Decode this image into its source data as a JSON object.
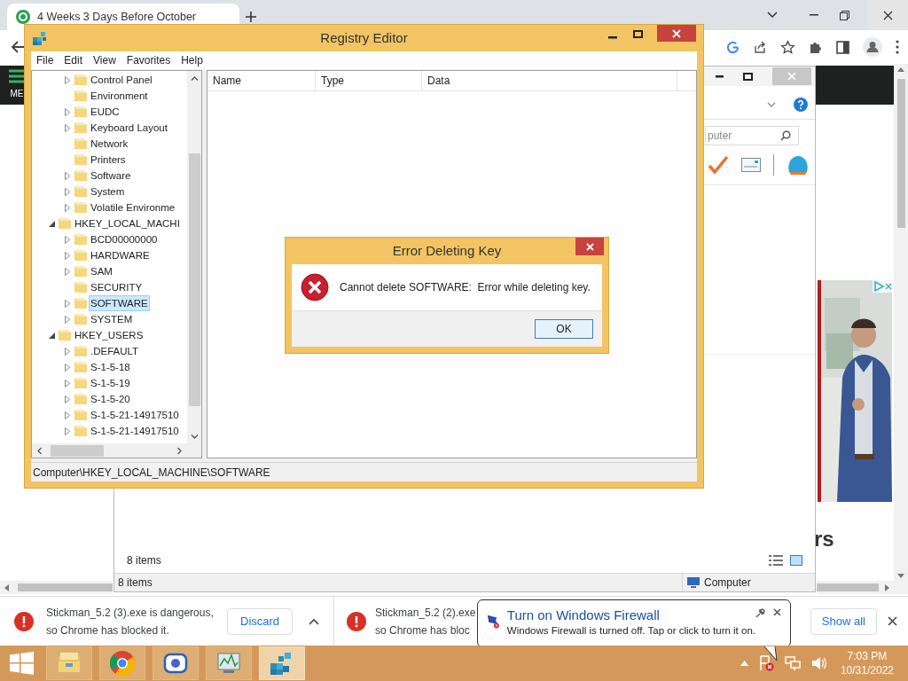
{
  "browser": {
    "tab": {
      "title": "4 Weeks 3 Days Before October"
    }
  },
  "page": {
    "menu_label": "ME",
    "heading_fragment": "rs"
  },
  "explorer": {
    "search": {
      "placeholder": "puter"
    },
    "item_count": "8 items",
    "status_bar": {
      "items": "8 items",
      "location": "Computer"
    }
  },
  "registry_editor": {
    "title": "Registry Editor",
    "menu": [
      "File",
      "Edit",
      "View",
      "Favorites",
      "Help"
    ],
    "tree": [
      {
        "children": [
          {
            "label": "Control Panel",
            "kind": "collapsed",
            "selected": false
          },
          {
            "label": "Environment",
            "kind": "leaf",
            "selected": false
          },
          {
            "label": "EUDC",
            "kind": "collapsed",
            "selected": false
          },
          {
            "label": "Keyboard Layout",
            "kind": "collapsed",
            "selected": false
          },
          {
            "label": "Network",
            "kind": "leaf",
            "selected": false
          },
          {
            "label": "Printers",
            "kind": "leaf",
            "selected": false
          },
          {
            "label": "Software",
            "kind": "collapsed",
            "selected": false
          },
          {
            "label": "System",
            "kind": "collapsed",
            "selected": false
          },
          {
            "label": "Volatile Environme",
            "kind": "collapsed",
            "selected": false
          }
        ]
      },
      {
        "label": "HKEY_LOCAL_MACHI",
        "kind": "expanded",
        "selected": false,
        "children": [
          {
            "label": "BCD00000000",
            "kind": "collapsed",
            "selected": false
          },
          {
            "label": "HARDWARE",
            "kind": "collapsed",
            "selected": false
          },
          {
            "label": "SAM",
            "kind": "collapsed",
            "selected": false
          },
          {
            "label": "SECURITY",
            "kind": "leaf",
            "selected": false
          },
          {
            "label": "SOFTWARE",
            "kind": "collapsed",
            "selected": true
          },
          {
            "label": "SYSTEM",
            "kind": "collapsed",
            "selected": false
          }
        ]
      },
      {
        "label": "HKEY_USERS",
        "kind": "expanded",
        "selected": false,
        "children": [
          {
            "label": ".DEFAULT",
            "kind": "collapsed",
            "selected": false
          },
          {
            "label": "S-1-5-18",
            "kind": "collapsed",
            "selected": false
          },
          {
            "label": "S-1-5-19",
            "kind": "collapsed",
            "selected": false
          },
          {
            "label": "S-1-5-20",
            "kind": "collapsed",
            "selected": false
          },
          {
            "label": "S-1-5-21-14917510",
            "kind": "collapsed",
            "selected": false
          },
          {
            "label": "S-1-5-21-14917510",
            "kind": "collapsed",
            "selected": false
          }
        ]
      }
    ],
    "columns": [
      "Name",
      "Type",
      "Data"
    ],
    "status_bar": "Computer\\HKEY_LOCAL_MACHINE\\SOFTWARE"
  },
  "dialog": {
    "title": "Error Deleting Key",
    "message": "Cannot delete SOFTWARE:  Error while deleting key.",
    "buttons": [
      "OK"
    ]
  },
  "downloads": {
    "items": [
      {
        "name": "Stickman_5.2 (3).exe is dangerous,",
        "detail": "so Chrome has blocked it.",
        "button": "Discard"
      },
      {
        "name": "Stickman_5.2 (2).exe",
        "detail": "so Chrome has bloc"
      }
    ],
    "show_all": "Show all"
  },
  "notification": {
    "title": "Turn on Windows Firewall",
    "message": "Windows Firewall is turned off. Tap or click to turn it on."
  },
  "taskbar": {
    "apps": [
      {
        "kind": "explorer",
        "selected": false
      },
      {
        "kind": "chrome",
        "selected": false
      },
      {
        "kind": "camera",
        "selected": false
      },
      {
        "kind": "monitor",
        "selected": false
      },
      {
        "kind": "regedit",
        "selected": true
      }
    ],
    "time": "7:03 PM",
    "date": "10/31/2022"
  }
}
